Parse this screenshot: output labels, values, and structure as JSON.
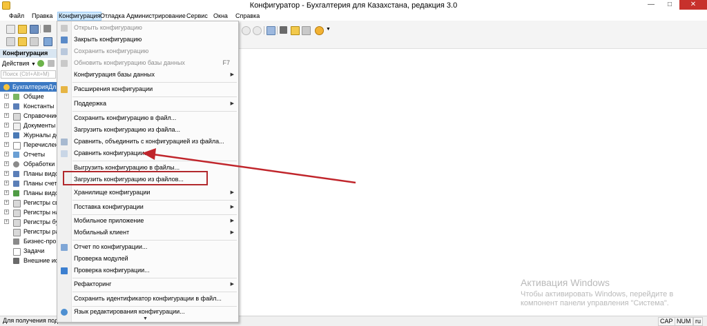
{
  "window": {
    "title": "Конфигуратор - Бухгалтерия для Казахстана, редакция 3.0",
    "controls": {
      "minimize": "—",
      "maximize": "□",
      "close": "✕"
    }
  },
  "menubar": [
    "Файл",
    "Правка",
    "Конфигурация",
    "Отладка",
    "Администрирование",
    "Сервис",
    "Окна",
    "Справка"
  ],
  "menubar_active": "Конфигурация",
  "left_panel": {
    "title": "Конфигурация",
    "actions_label": "Действия",
    "search_placeholder": "Поиск (Ctrl+Alt+M)",
    "tree": [
      "БухгалтерияДл",
      "Общие",
      "Константы",
      "Справочник",
      "Документы",
      "Журналы до",
      "Перечислен",
      "Отчеты",
      "Обработки",
      "Планы видо",
      "Планы счет",
      "Планы видо",
      "Регистры св",
      "Регистры на",
      "Регистры бу",
      "Регистры ра",
      "Бизнес-проц",
      "Задачи",
      "Внешние ис"
    ]
  },
  "dropdown": {
    "items": [
      {
        "label": "Открыть конфигурацию",
        "disabled": true,
        "shortcut": "",
        "submenu": false,
        "icon": "open-config-icon"
      },
      {
        "label": "Закрыть конфигурацию",
        "disabled": false,
        "shortcut": "",
        "submenu": false,
        "icon": "close-config-icon"
      },
      {
        "label": "Сохранить конфигурацию",
        "disabled": true,
        "shortcut": "",
        "submenu": false,
        "icon": "save-config-icon"
      },
      {
        "label": "Обновить конфигурацию базы данных",
        "disabled": true,
        "shortcut": "F7",
        "submenu": false,
        "icon": "update-db-icon"
      },
      {
        "label": "Конфигурация базы данных",
        "disabled": false,
        "shortcut": "",
        "submenu": true,
        "icon": ""
      },
      {
        "label": "Расширения конфигурации",
        "disabled": false,
        "shortcut": "",
        "submenu": false,
        "icon": "extensions-icon"
      },
      {
        "label": "Поддержка",
        "disabled": false,
        "shortcut": "",
        "submenu": true,
        "icon": ""
      },
      {
        "label": "Сохранить конфигурацию в файл...",
        "disabled": false,
        "shortcut": "",
        "submenu": false,
        "icon": ""
      },
      {
        "label": "Загрузить конфигурацию из файла...",
        "disabled": false,
        "shortcut": "",
        "submenu": false,
        "icon": ""
      },
      {
        "label": "Сравнить, объединить с конфигурацией из файла...",
        "disabled": false,
        "shortcut": "",
        "submenu": false,
        "icon": "merge-icon"
      },
      {
        "label": "Сравнить конфигурации...",
        "disabled": false,
        "shortcut": "",
        "submenu": false,
        "icon": "compare-icon"
      },
      {
        "label": "Выгрузить конфигурацию в файлы...",
        "disabled": false,
        "shortcut": "",
        "submenu": false,
        "icon": ""
      },
      {
        "label": "Загрузить конфигурацию из файлов...",
        "disabled": false,
        "shortcut": "",
        "submenu": false,
        "icon": ""
      },
      {
        "label": "Хранилище конфигурации",
        "disabled": false,
        "shortcut": "",
        "submenu": true,
        "icon": ""
      },
      {
        "label": "Поставка конфигурации",
        "disabled": false,
        "shortcut": "",
        "submenu": true,
        "icon": ""
      },
      {
        "label": "Мобильное приложение",
        "disabled": false,
        "shortcut": "",
        "submenu": true,
        "icon": ""
      },
      {
        "label": "Мобильный клиент",
        "disabled": false,
        "shortcut": "",
        "submenu": true,
        "icon": ""
      },
      {
        "label": "Отчет по конфигурации...",
        "disabled": false,
        "shortcut": "",
        "submenu": false,
        "icon": "report-icon"
      },
      {
        "label": "Проверка модулей",
        "disabled": false,
        "shortcut": "",
        "submenu": false,
        "icon": ""
      },
      {
        "label": "Проверка конфигурации...",
        "disabled": false,
        "shortcut": "",
        "submenu": false,
        "icon": "check-icon"
      },
      {
        "label": "Рефакторинг",
        "disabled": false,
        "shortcut": "",
        "submenu": true,
        "icon": ""
      },
      {
        "label": "Сохранить идентификатор конфигурации в файл...",
        "disabled": false,
        "shortcut": "",
        "submenu": false,
        "icon": ""
      },
      {
        "label": "Язык редактирования конфигурации...",
        "disabled": false,
        "shortcut": "",
        "submenu": false,
        "icon": "language-icon"
      }
    ],
    "more_arrow": "▼"
  },
  "status": {
    "text": "Для получения подс",
    "indicators": [
      "CAP",
      "NUM",
      "ru"
    ]
  },
  "watermark": {
    "title": "Активация Windows",
    "text": "Чтобы активировать Windows, перейдите в компонент панели управления \"Система\"."
  },
  "colors": {
    "highlight_box": "#b2282c",
    "arrow": "#c0252b",
    "menu_active_bg": "#cde8ff",
    "tree_selected_bg": "#3a78c3"
  }
}
